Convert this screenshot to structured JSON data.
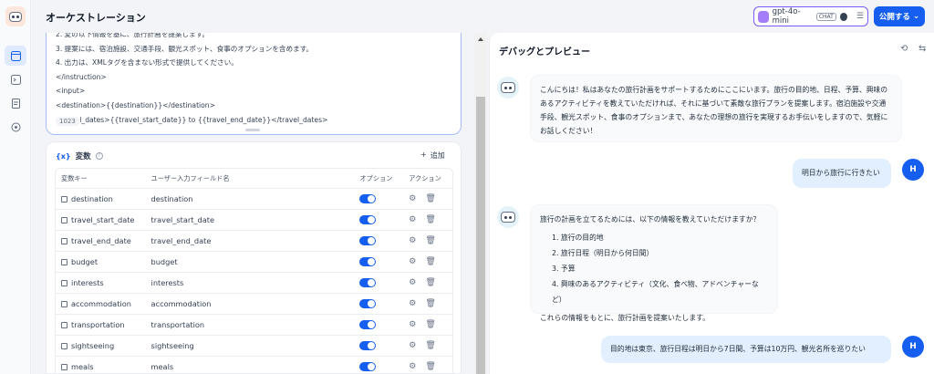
{
  "header": {
    "title": "オーケストレーション",
    "model": {
      "name": "gpt-4o-mini",
      "badge": "CHAT",
      "icon": "model-settings-icon"
    },
    "publish_label": "公開する",
    "colors": {
      "accent": "#155eef",
      "model_border": "#7a5af8"
    }
  },
  "rail": {
    "items": [
      {
        "icon": "layout-icon",
        "active": true
      },
      {
        "icon": "terminal-icon",
        "active": false
      },
      {
        "icon": "document-icon",
        "active": false
      },
      {
        "icon": "monitor-icon",
        "active": false
      }
    ]
  },
  "prompt": {
    "lines": [
      "2. 変の以下情報を基に、旅行計画を提案します。",
      "3. 提案には、宿泊施設、交通手段、観光スポット、食事のオプションを含めます。",
      "4. 出力は、XMLタグを含まない形式で提供してください。",
      "</instruction>",
      "<input>",
      "<destination>{{destination}}</destination>",
      "<travel_dates>{{travel_start_date}} to {{travel_end_date}}</travel_dates>"
    ],
    "char_count": "1023"
  },
  "variables": {
    "title": "変数",
    "add_label": "追加",
    "columns": {
      "key": "変数キー",
      "field": "ユーザー入力フィールド名",
      "optional": "オプション",
      "action": "アクション"
    },
    "rows": [
      {
        "key": "destination",
        "field": "destination"
      },
      {
        "key": "travel_start_date",
        "field": "travel_start_date"
      },
      {
        "key": "travel_end_date",
        "field": "travel_end_date"
      },
      {
        "key": "budget",
        "field": "budget"
      },
      {
        "key": "interests",
        "field": "interests"
      },
      {
        "key": "accommodation",
        "field": "accommodation"
      },
      {
        "key": "transportation",
        "field": "transportation"
      },
      {
        "key": "sightseeing",
        "field": "sightseeing"
      },
      {
        "key": "meals",
        "field": "meals"
      }
    ]
  },
  "debug": {
    "title": "デバッグとプレビュー",
    "user_initial": "H",
    "messages": {
      "bot1": "こんにちは！私はあなたの旅行計画をサポートするためにここにいます。旅行の目的地、日程、予算、興味のあるアクティビティを教えていただければ、それに基づいて素敵な旅行プランを提案します。宿泊施設や交通手段、観光スポット、食事のオプションまで、あなたの理想の旅行を実現するお手伝いをしますので、気軽にお話しください！",
      "user1": "明日から旅行に行きたい",
      "bot2_intro": "旅行の計画を立てるためには、以下の情報を教えていただけますか？",
      "bot2_list": [
        "1. 旅行の目的地",
        "2. 旅行日程（明日から何日間）",
        "3. 予算",
        "4. 興味のあるアクティビティ（文化、食べ物、アドベンチャーなど）"
      ],
      "bot2_outro": "これらの情報をもとに、旅行計画を提案いたします。",
      "user2": "目的地は東京、旅行日程は明日から7日間、予算は10万円、観光名所を巡りたい"
    }
  }
}
